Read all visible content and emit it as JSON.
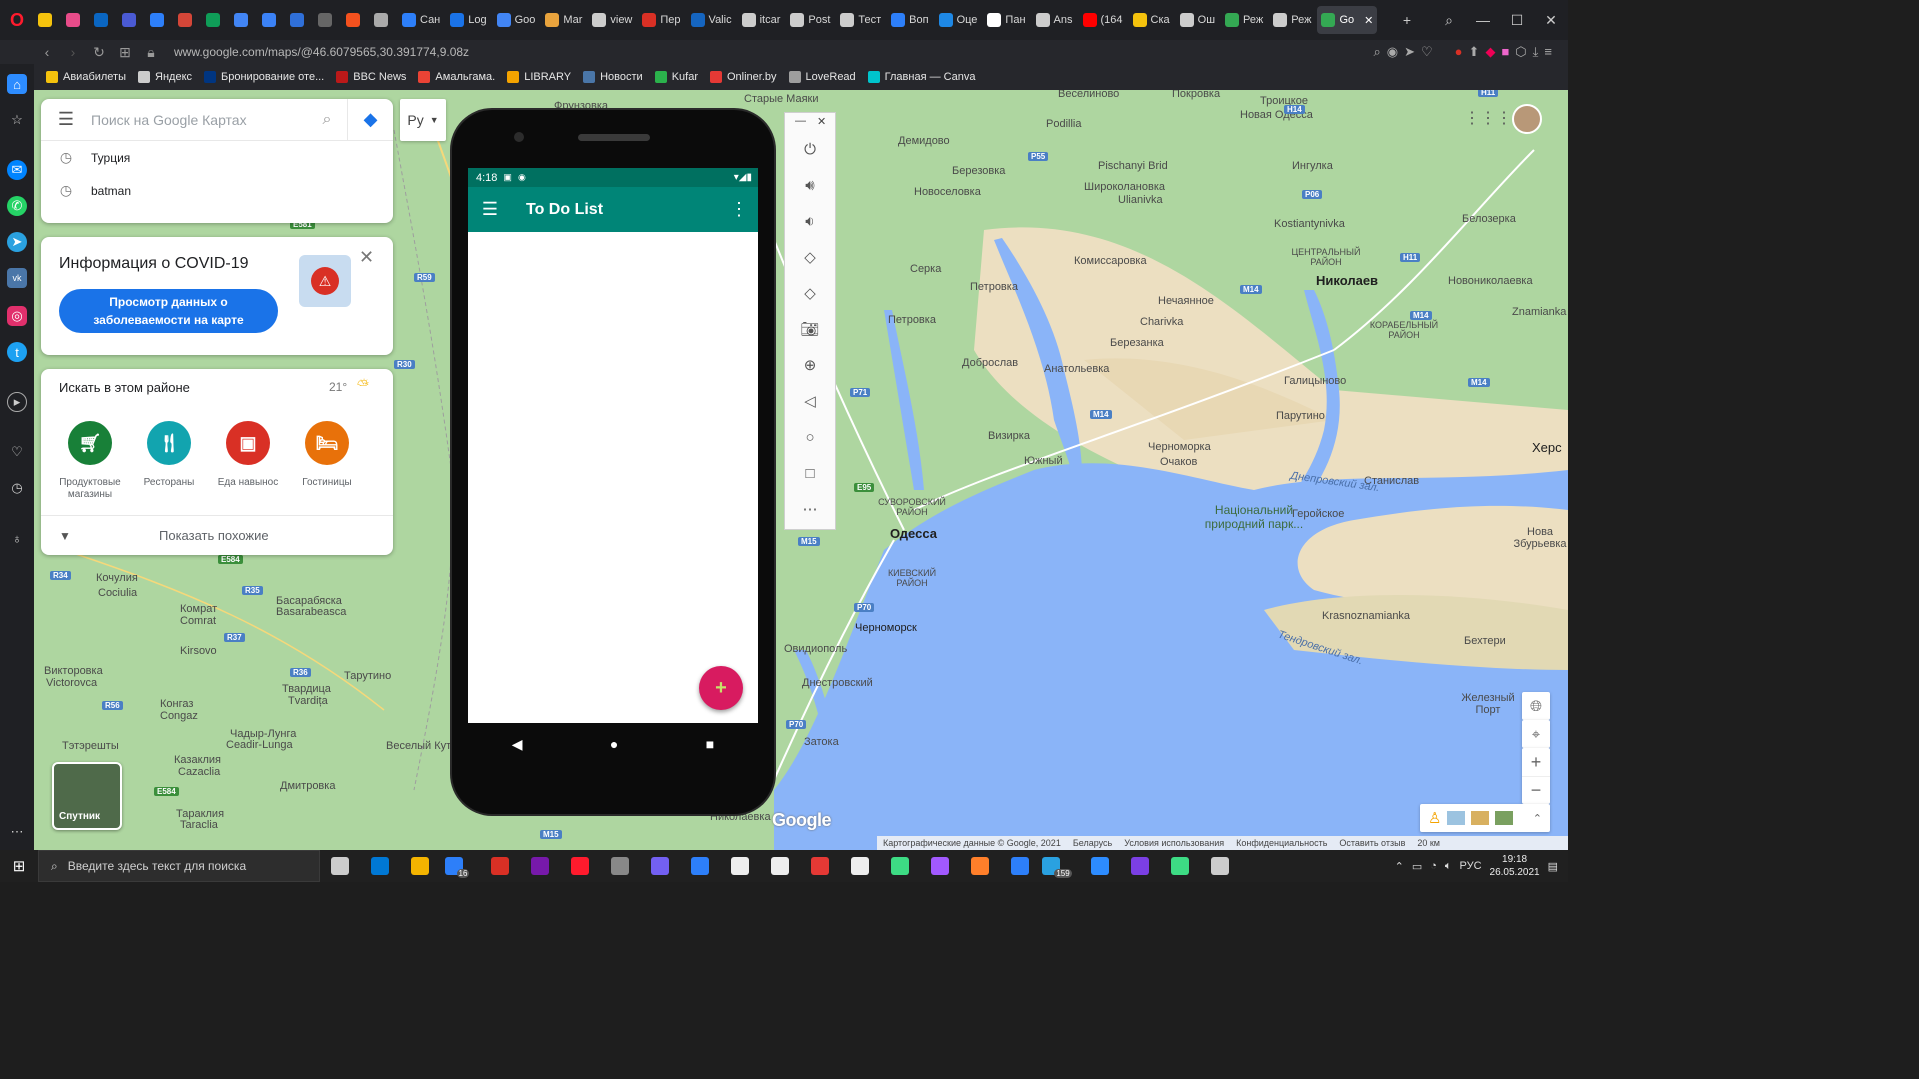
{
  "browser": {
    "tabs": [
      {
        "label": "",
        "color": "#f4c20d"
      },
      {
        "label": "",
        "color": "#e84c8a"
      },
      {
        "label": "",
        "color": "#0a66c2"
      },
      {
        "label": "",
        "color": "#4a5ad4"
      },
      {
        "label": "",
        "color": "#2d7ff9"
      },
      {
        "label": "",
        "color": "#d44638"
      },
      {
        "label": "",
        "color": "#0f9d58"
      },
      {
        "label": "",
        "color": "#4285f4"
      },
      {
        "label": "",
        "color": "#3b82f6"
      },
      {
        "label": "",
        "color": "#2f6fd8"
      },
      {
        "label": "",
        "color": "#666666"
      },
      {
        "label": "",
        "color": "#f4511e"
      },
      {
        "label": "",
        "color": "#aaaaaa"
      },
      {
        "label": "Сан",
        "color": "#2d7ff9"
      },
      {
        "label": "Log",
        "color": "#1a73e8"
      },
      {
        "label": "Goo",
        "color": "#4285f4"
      },
      {
        "label": "Mar",
        "color": "#e8a33d"
      },
      {
        "label": "view",
        "color": "#cccccc"
      },
      {
        "label": "Пер",
        "color": "#d93025"
      },
      {
        "label": "Valic",
        "color": "#1565c0"
      },
      {
        "label": "itcar",
        "color": "#cccccc"
      },
      {
        "label": "Post",
        "color": "#cccccc"
      },
      {
        "label": "Тест",
        "color": "#cccccc"
      },
      {
        "label": "Воп",
        "color": "#2d7ff9"
      },
      {
        "label": "Оце",
        "color": "#1e88e5"
      },
      {
        "label": "Пан",
        "color": "#ffffff"
      },
      {
        "label": "Ans",
        "color": "#cccccc"
      },
      {
        "label": "(164",
        "color": "#ff0000"
      },
      {
        "label": "Ска",
        "color": "#f4c20d"
      },
      {
        "label": "Ош",
        "color": "#cccccc"
      },
      {
        "label": "Реж",
        "color": "#34a853"
      },
      {
        "label": "Реж",
        "color": "#cccccc"
      },
      {
        "label": "Go",
        "color": "#34a853",
        "active": true
      }
    ],
    "url": "www.google.com/maps/@46.6079565,30.391774,9.08z",
    "bookmarks": [
      {
        "label": "Авиабилеты",
        "color": "#f4c20d"
      },
      {
        "label": "Яндекс",
        "color": "#cccccc"
      },
      {
        "label": "Бронирование оте...",
        "color": "#003580"
      },
      {
        "label": "BBC News",
        "color": "#bb1919"
      },
      {
        "label": "Амальгама.",
        "color": "#ea4335"
      },
      {
        "label": "LIBRARY",
        "color": "#f4a300"
      },
      {
        "label": "Новости",
        "color": "#4a76a8"
      },
      {
        "label": "Kufar",
        "color": "#2bb24c"
      },
      {
        "label": "Onliner.by",
        "color": "#e53935"
      },
      {
        "label": "LoveRead",
        "color": "#9e9e9e"
      },
      {
        "label": "Главная — Canva",
        "color": "#00c4cc"
      }
    ]
  },
  "maps": {
    "search_placeholder": "Поиск на Google Картах",
    "history": [
      "Турция",
      "batman"
    ],
    "language_label": "Ру",
    "covid": {
      "title": "Информация о COVID-19",
      "button": "Просмотр данных о заболеваемости на карте"
    },
    "nearby": {
      "title": "Искать в этом районе",
      "temperature": "21°",
      "categories": [
        {
          "label": "Продуктовые магазины",
          "color": "#188038",
          "icon": "cart-icon"
        },
        {
          "label": "Рестораны",
          "color": "#12a4af",
          "icon": "restaurant-icon"
        },
        {
          "label": "Еда навынос",
          "color": "#d93025",
          "icon": "takeout-icon"
        },
        {
          "label": "Гостиницы",
          "color": "#e8710a",
          "icon": "hotel-icon"
        }
      ],
      "show_more": "Показать похожие"
    },
    "satellite_label": "Спутник",
    "attribution": [
      "Картографические данные © Google, 2021",
      "Беларусь",
      "Условия использования",
      "Конфиденциальность",
      "Оставить отзыв",
      "20 км"
    ],
    "labels": {
      "odessa": "Одесса",
      "nikolaev": "Николаев",
      "chernomorsk": "Черноморск",
      "demidovo": "Демидово",
      "berezovka": "Березовка",
      "novoselovka": "Новоселовка",
      "serka": "Серка",
      "petrovka1": "Петровка",
      "petrovka2": "Петровка",
      "dobroslav": "Доброслав",
      "anatolevka": "Анатольевка",
      "vizirka": "Визирка",
      "yuzhny": "Южный",
      "chernomorka": "Черноморка",
      "ochakov": "Очаков",
      "ovidiopol": "Овидиополь",
      "zatoka": "Затока",
      "kominternovo": "Комиссаровка",
      "nechaiannoe": "Нечаянное",
      "berezanka": "Березанка",
      "gulicinovo": "Галицыново",
      "parutino": "Парутино",
      "stanislav": "Станислав",
      "geroiskoe": "Геройское",
      "krasnoznamianka": "Krasnoznamianka",
      "bekhtery": "Бехтери",
      "zheleznyi_port": "Железный Порт",
      "nova_zburievka": "Нова Збурьевка",
      "novoodessa": "Новая Одесса",
      "troickoe": "Троицкое",
      "pokrovka": "Покровка",
      "veselinovo": "Веселиново",
      "starye_maiaki": "Старые Маяки",
      "frunzovka": "Фрунзовка",
      "ingulka": "Ингулка",
      "belozerka": "Белозерка",
      "novonikolaevka": "Новониколаевка",
      "znamianka": "Znamianka",
      "kostiantynivka": "Kostiantynivka",
      "pischanyi_brid": "Pischanyi Brid",
      "shirokolanovka": "Широколановка",
      "ulianivka": "Ulianivka",
      "podilia": "Podillia",
      "charivka": "Charivka",
      "kochulia": "Кочулия",
      "cociulia": "Cociulia",
      "komrat": "Комрат",
      "comrat": "Comrat",
      "kirsovo": "Kirsovo",
      "basarabeasca": "Басарабяска",
      "basarabeasca2": "Basarabeasca",
      "viktorovka": "Викторовка",
      "victorovca": "Victorovca",
      "konga": "Конгаз",
      "congaz": "Congaz",
      "tvardica": "Твардица",
      "tvardita": "Tvardița",
      "ceadir": "Чадыр-Лунга",
      "ceadirlunga": "Ceadir-Lunga",
      "kazakliia": "Казаклия",
      "cazaclia": "Cazaclia",
      "taraklia": "Тараклия",
      "taraclia": "Taraclia",
      "tatareshty": "Тэтэрешты",
      "tarutino": "Тарутино",
      "veselyi_kut": "Веселый Кут",
      "dmitrovka": "Дмитровка",
      "nikolaevka": "Николаевка",
      "dnestrovsky": "Днестровский",
      "central_district": "ЦЕНТРАЛЬНЫЙ РАЙОН",
      "korabelny": "КОРАБЕЛЬНЫЙ РАЙОН",
      "suvorovsky": "СУВОРОВСКИЙ РАЙОН",
      "kievsky": "КИЕВСКИЙ РАЙОН",
      "national_park": "Національний природний парк...",
      "dnieper_bay": "Днепровский зал.",
      "tendra_bay": "Тендровский зал.",
      "kherson": "Херс"
    }
  },
  "emulator": {
    "time": "4:18",
    "app_title": "To Do List",
    "fab_label": "+"
  },
  "taskbar": {
    "search_placeholder": "Введите здесь текст для поиска",
    "apps": [
      {
        "color": "#cccccc"
      },
      {
        "color": "#0078d4"
      },
      {
        "color": "#f4b400"
      },
      {
        "color": "#2d7ff9"
      },
      {
        "color": "#d93025"
      },
      {
        "color": "#7719aa"
      },
      {
        "color": "#ff1b2d"
      },
      {
        "color": "#888888"
      },
      {
        "color": "#7360f2"
      },
      {
        "color": "#2d7ff9"
      },
      {
        "color": "#eeeeee"
      },
      {
        "color": "#eeeeee"
      },
      {
        "color": "#e53935"
      },
      {
        "color": "#eeeeee"
      },
      {
        "color": "#3ddc84"
      },
      {
        "color": "#a259ff"
      },
      {
        "color": "#ff7f2a"
      },
      {
        "color": "#2d7ff9"
      },
      {
        "color": "#2aa1e0"
      },
      {
        "color": "#2d8cff"
      },
      {
        "color": "#7b3fe4"
      },
      {
        "color": "#3ddc84"
      },
      {
        "color": "#cccccc"
      }
    ],
    "mail_badge": "16",
    "telegram_badge": "159",
    "language": "РУС",
    "time": "19:18",
    "date": "26.05.2021"
  }
}
